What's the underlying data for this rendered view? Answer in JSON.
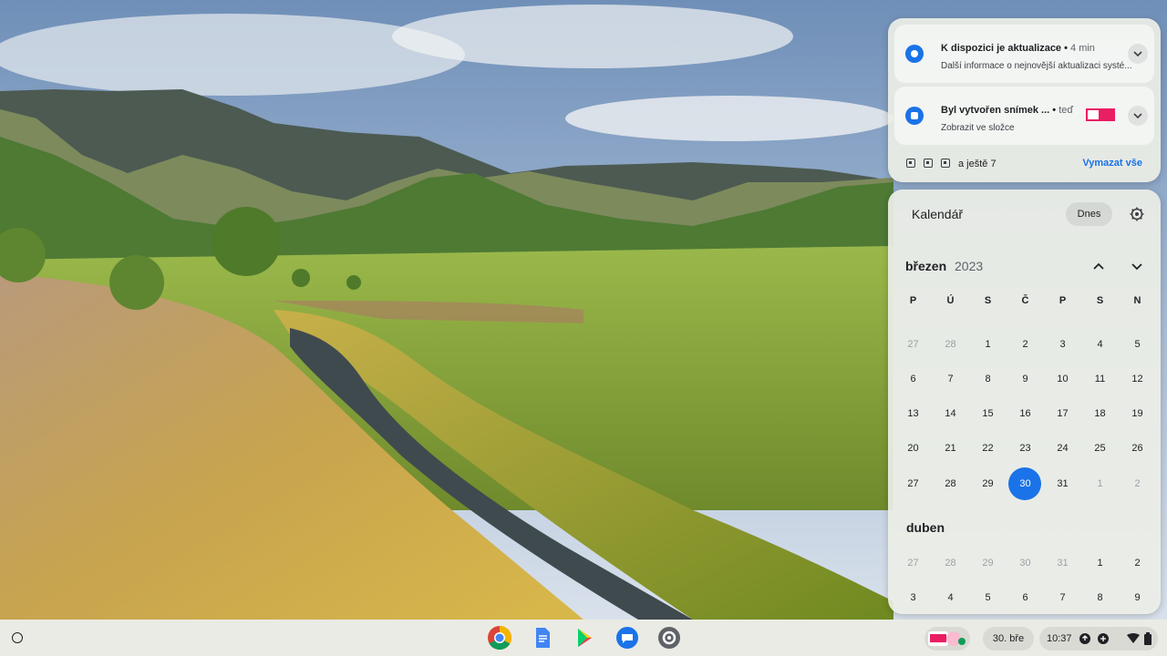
{
  "notifications": [
    {
      "title": "K dispozici je aktualizace",
      "time": "4 min",
      "body": "Další informace o nejnovější aktualizaci systé...",
      "icon": "system-update-icon"
    },
    {
      "title": "Byl vytvořen snímek ...",
      "time": "teď",
      "body": "Zobrazit ve složce",
      "icon": "screenshot-icon"
    }
  ],
  "notif_footer": {
    "more": "a ještě 7",
    "clear": "Vymazat vše"
  },
  "calendar": {
    "title": "Kalendář",
    "today_label": "Dnes",
    "month": "březen",
    "year": "2023",
    "next_month": "duben",
    "weekdays": [
      "P",
      "Ú",
      "S",
      "Č",
      "P",
      "S",
      "N"
    ],
    "weeks": [
      [
        "27",
        "28",
        "1",
        "2",
        "3",
        "4",
        "5"
      ],
      [
        "6",
        "7",
        "8",
        "9",
        "10",
        "11",
        "12"
      ],
      [
        "13",
        "14",
        "15",
        "16",
        "17",
        "18",
        "19"
      ],
      [
        "20",
        "21",
        "22",
        "23",
        "24",
        "25",
        "26"
      ],
      [
        "27",
        "28",
        "29",
        "30",
        "31",
        "1",
        "2"
      ]
    ],
    "next_weeks": [
      [
        "27",
        "28",
        "29",
        "30",
        "31",
        "1",
        "2"
      ],
      [
        "3",
        "4",
        "5",
        "6",
        "7",
        "8",
        "9"
      ]
    ],
    "selected_day": "30"
  },
  "shelf": {
    "apps": [
      "Chrome",
      "Docs",
      "Play Store",
      "Messages",
      "Settings"
    ],
    "date": "30. bře",
    "time": "10:37"
  },
  "colors": {
    "accent": "#1a73e8"
  }
}
